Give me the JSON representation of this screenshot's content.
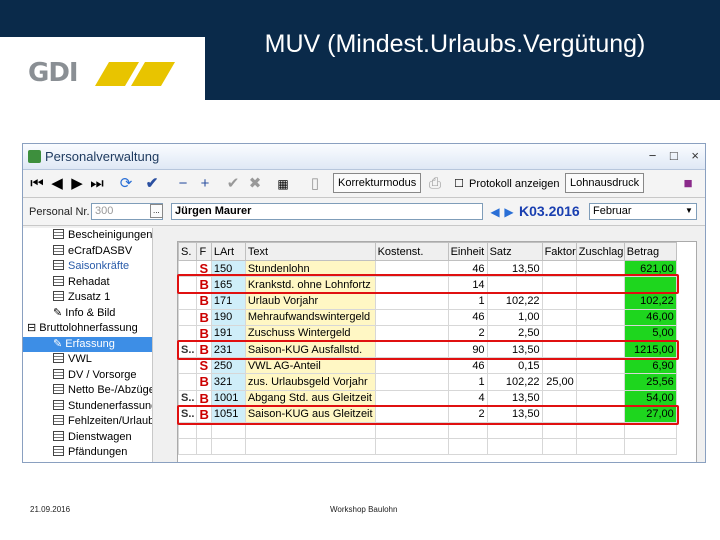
{
  "slide": {
    "title": "MUV (Mindest.Urlaubs.Vergütung)",
    "logo_text": "GDI",
    "footer_date": "21.09.2016",
    "footer_text": "Workshop Baulohn"
  },
  "window": {
    "title": "Personalverwaltung",
    "buttons": {
      "minimize": "−",
      "restore": "□",
      "close": "×"
    }
  },
  "toolbar": {
    "korrekturmodus": "Korrekturmodus",
    "protokoll": "Protokoll anzeigen",
    "lohnausdruck": "Lohnausdruck"
  },
  "filter": {
    "personal_label": "Personal Nr.",
    "personal_value": "300",
    "name_value": "Jürgen Maurer",
    "period": "K03.2016",
    "month": "Februar"
  },
  "tree": [
    {
      "label": "Bescheinigungen",
      "style": "ic"
    },
    {
      "label": "eCrafDASBV",
      "style": "ic"
    },
    {
      "label": "Saisonkräfte",
      "style": "ic gray"
    },
    {
      "label": "Rehadat",
      "style": "ic"
    },
    {
      "label": "Zusatz 1",
      "style": "ic"
    },
    {
      "label": "Info & Bild",
      "style": "pen"
    },
    {
      "label": "Bruttolohnerfassung",
      "style": "folder"
    },
    {
      "label": "Erfassung",
      "style": "sel"
    },
    {
      "label": "VWL",
      "style": "ic"
    },
    {
      "label": "DV / Vorsorge",
      "style": "ic"
    },
    {
      "label": "Netto Be-/Abzüge",
      "style": "ic"
    },
    {
      "label": "Stundenerfassung",
      "style": "ic"
    },
    {
      "label": "Fehlzeiten/Urlaub",
      "style": "ic"
    },
    {
      "label": "Dienstwagen",
      "style": "ic"
    },
    {
      "label": "Pfändungen",
      "style": "ic"
    }
  ],
  "grid": {
    "headers": [
      "S.",
      "F",
      "LArt",
      "Text",
      "Kostenst.",
      "Einheit",
      "Satz",
      "Faktor",
      "Zuschlag",
      "Betrag"
    ],
    "rows": [
      {
        "s": "",
        "f": "S",
        "lart": "150",
        "text": "Stundenlohn",
        "kost": "",
        "einheit": "46",
        "satz": "13,50",
        "faktor": "",
        "zuschlag": "",
        "betrag": "621,00",
        "hl": true
      },
      {
        "s": "",
        "f": "B",
        "lart": "165",
        "text": "Krankstd. ohne Lohnfortz",
        "kost": "",
        "einheit": "14",
        "satz": "",
        "faktor": "",
        "zuschlag": "",
        "betrag": "",
        "hl": true
      },
      {
        "s": "",
        "f": "B",
        "lart": "171",
        "text": "Urlaub Vorjahr",
        "kost": "",
        "einheit": "1",
        "satz": "102,22",
        "faktor": "",
        "zuschlag": "",
        "betrag": "102,22",
        "hl": true
      },
      {
        "s": "",
        "f": "B",
        "lart": "190",
        "text": "Mehraufwandswintergeld",
        "kost": "",
        "einheit": "46",
        "satz": "1,00",
        "faktor": "",
        "zuschlag": "",
        "betrag": "46,00",
        "hl": true
      },
      {
        "s": "",
        "f": "B",
        "lart": "191",
        "text": "Zuschuss Wintergeld",
        "kost": "",
        "einheit": "2",
        "satz": "2,50",
        "faktor": "",
        "zuschlag": "",
        "betrag": "5,00",
        "hl": true
      },
      {
        "s": "S..",
        "f": "B",
        "lart": "231",
        "text": "Saison-KUG Ausfallstd.",
        "kost": "",
        "einheit": "90",
        "satz": "13,50",
        "faktor": "",
        "zuschlag": "",
        "betrag": "1215,00",
        "hl": true
      },
      {
        "s": "",
        "f": "S",
        "lart": "250",
        "text": "VWL AG-Anteil",
        "kost": "",
        "einheit": "46",
        "satz": "0,15",
        "faktor": "",
        "zuschlag": "",
        "betrag": "6,90",
        "hl": true
      },
      {
        "s": "",
        "f": "B",
        "lart": "321",
        "text": "zus. Urlaubsgeld Vorjahr",
        "kost": "",
        "einheit": "1",
        "satz": "102,22",
        "faktor": "25,00",
        "zuschlag": "",
        "betrag": "25,56",
        "hl": true
      },
      {
        "s": "S..",
        "f": "B",
        "lart": "1001",
        "text": "Abgang Std. aus Gleitzeit",
        "kost": "",
        "einheit": "4",
        "satz": "13,50",
        "faktor": "",
        "zuschlag": "",
        "betrag": "54,00",
        "hl": true
      },
      {
        "s": "S..",
        "f": "B",
        "lart": "1051",
        "text": "Saison-KUG aus Gleitzeit",
        "kost": "",
        "einheit": "2",
        "satz": "13,50",
        "faktor": "",
        "zuschlag": "",
        "betrag": "27,00",
        "hl": true
      },
      {
        "s": "",
        "f": "",
        "lart": "",
        "text": "",
        "kost": "",
        "einheit": "",
        "satz": "",
        "faktor": "",
        "zuschlag": "",
        "betrag": "",
        "hl": false
      },
      {
        "s": "",
        "f": "",
        "lart": "",
        "text": "",
        "kost": "",
        "einheit": "",
        "satz": "",
        "faktor": "",
        "zuschlag": "",
        "betrag": "",
        "hl": false
      }
    ]
  }
}
